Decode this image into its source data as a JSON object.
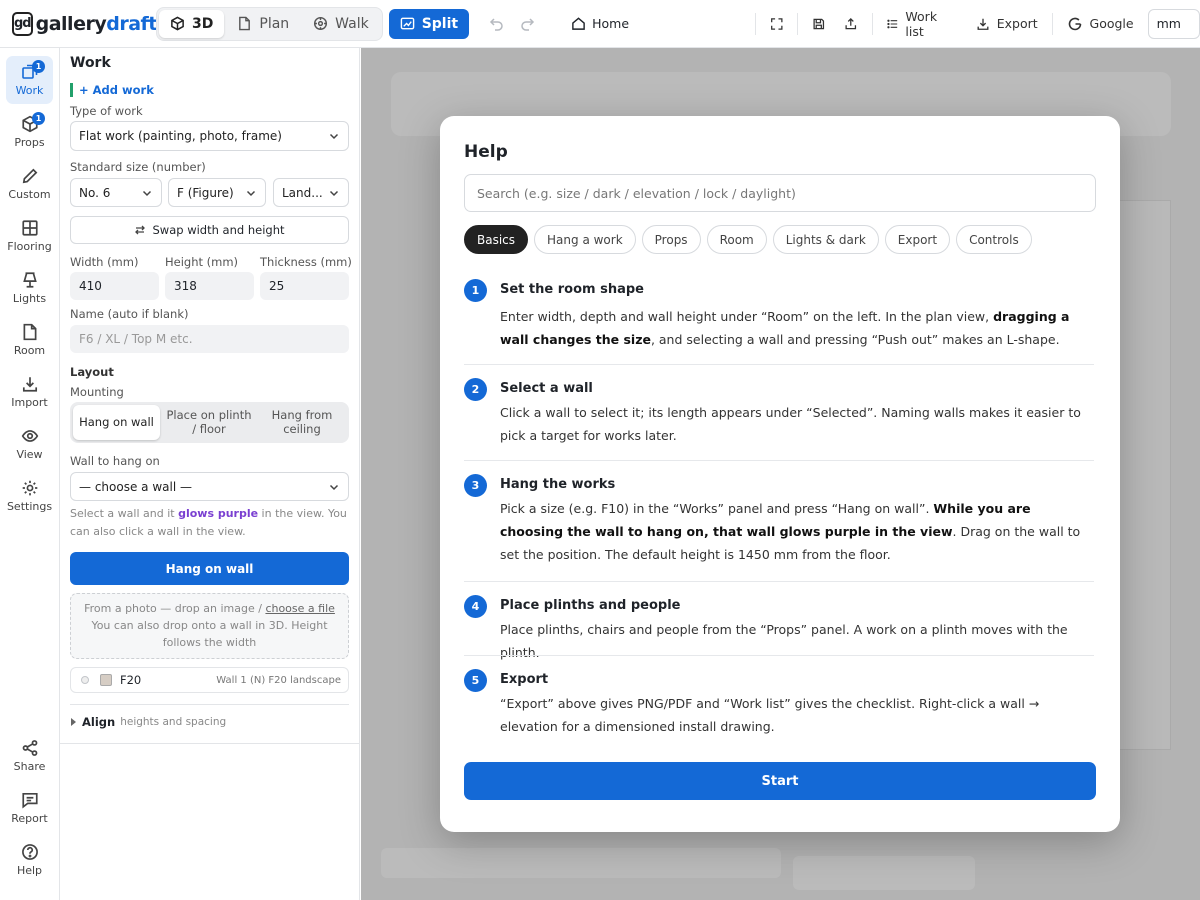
{
  "app": {
    "logo_mark": "gd",
    "logo_part1": "gallery",
    "logo_part2": "draft"
  },
  "topbar": {
    "views": [
      {
        "label": "3D",
        "icon": "cube-icon"
      },
      {
        "label": "Plan",
        "icon": "plan-icon"
      },
      {
        "label": "Walk",
        "icon": "walk-icon"
      },
      {
        "label": "Split",
        "icon": "split-icon"
      }
    ],
    "home": "Home",
    "work_list": "Work list",
    "export": "Export",
    "account": "Google",
    "unit": "mm"
  },
  "rail": {
    "items": [
      {
        "label": "Work",
        "badge": "1"
      },
      {
        "label": "Props",
        "badge": "1"
      },
      {
        "label": "Custom"
      },
      {
        "label": "Flooring"
      },
      {
        "label": "Lights"
      },
      {
        "label": "Room"
      },
      {
        "label": "Import"
      },
      {
        "label": "View"
      },
      {
        "label": "Settings"
      }
    ],
    "bottom": [
      {
        "label": "Share"
      },
      {
        "label": "Report"
      },
      {
        "label": "Help"
      }
    ]
  },
  "panel": {
    "title": "Work",
    "add_work": "+ Add work",
    "type_label": "Type of work",
    "type_value": "Flat work (painting, photo, frame)",
    "std_label": "Standard size (number)",
    "std_number": "No. 6",
    "std_kind": "F (Figure)",
    "std_orient": "Land...",
    "swap": "Swap width and height",
    "width_label": "Width (mm)",
    "height_label": "Height (mm)",
    "thick_label": "Thickness (mm)",
    "width": "410",
    "height": "318",
    "thickness": "25",
    "name_label": "Name (auto if blank)",
    "name_placeholder": "F6 / XL / Top M etc.",
    "layout": "Layout",
    "mounting": "Mounting",
    "mount_options": [
      "Hang on wall",
      "Place on plinth / floor",
      "Hang from ceiling"
    ],
    "wall_label": "Wall to hang on",
    "wall_value": "— choose a wall —",
    "note_pre": "Select a wall and it ",
    "note_em": "glows purple",
    "note_post": " in the view. You can also click a wall in the view.",
    "hang_button": "Hang on wall",
    "drop_line1_pre": "From a photo — drop an image / ",
    "drop_link": "choose a file",
    "drop_line2": "You can also drop onto a wall in 3D. Height follows the width",
    "work_item": {
      "name": "F20",
      "meta": "Wall 1 (N) F20 landscape",
      "swatch": "#d6cdc4"
    },
    "align_label": "Align",
    "align_sub": "heights and spacing"
  },
  "help": {
    "title": "Help",
    "search_placeholder": "Search (e.g. size / dark / elevation / lock / daylight)",
    "tabs": [
      "Basics",
      "Hang a work",
      "Props",
      "Room",
      "Lights & dark",
      "Export",
      "Controls"
    ],
    "steps": [
      {
        "n": "1",
        "title": "Set the room shape",
        "p1": "Enter width, depth and wall height under “Room” on the left. In the plan view, ",
        "b1": "dragging a wall changes the size",
        "p2": ", and selecting a wall and pressing “Push out” makes an L-shape.",
        "b2": "",
        "p3": ""
      },
      {
        "n": "2",
        "title": "Select a wall",
        "p1": "Click a wall to select it; its length appears under “Selected”. Naming walls makes it easier to pick a target for works later.",
        "b1": "",
        "p2": "",
        "b2": "",
        "p3": ""
      },
      {
        "n": "3",
        "title": "Hang the works",
        "p1": "Pick a size (e.g. F10) in the “Works” panel and press “Hang on wall”. ",
        "b1": "While you are choosing the wall to hang on, that wall glows purple in the view",
        "p2": ". Drag on the wall to set the position. The default height is 1450 mm from the floor.",
        "b2": "",
        "p3": ""
      },
      {
        "n": "4",
        "title": "Place plinths and people",
        "p1": "Place plinths, chairs and people from the “Props” panel. A work on a plinth moves with the plinth.",
        "b1": "",
        "p2": "",
        "b2": "",
        "p3": ""
      },
      {
        "n": "5",
        "title": "Export",
        "p1": "“Export” above gives PNG/PDF and “Work list” gives the checklist. Right-click a wall → elevation for a dimensioned install drawing.",
        "b1": "",
        "p2": "",
        "b2": "",
        "p3": ""
      }
    ],
    "start": "Start"
  },
  "colors": {
    "accent": "#1469d6",
    "purple": "#7a3fd1",
    "green": "#22a06b"
  }
}
